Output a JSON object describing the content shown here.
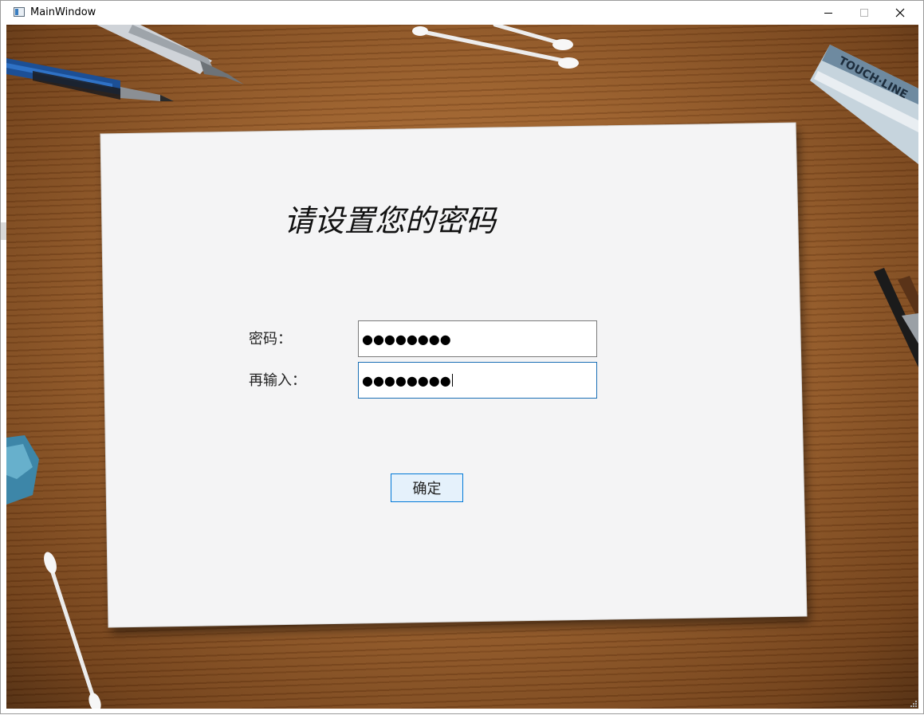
{
  "window": {
    "title": "MainWindow"
  },
  "form": {
    "heading": "请设置您的密码",
    "password_label": "密码：",
    "password_value": "●●●●●●●●",
    "confirm_label": "再输入：",
    "confirm_value": "●●●●●●●●",
    "submit_label": "确定"
  },
  "icons": {
    "app": "app-window-icon",
    "minimize": "minimize-icon",
    "maximize": "maximize-icon",
    "close": "close-icon",
    "resize_grip": "resize-grip-icon"
  },
  "colors": {
    "field_focus_border": "#1a6fb5",
    "button_border": "#0078d7",
    "button_bg": "#e5f1fb",
    "paper": "#f4f4f5"
  }
}
